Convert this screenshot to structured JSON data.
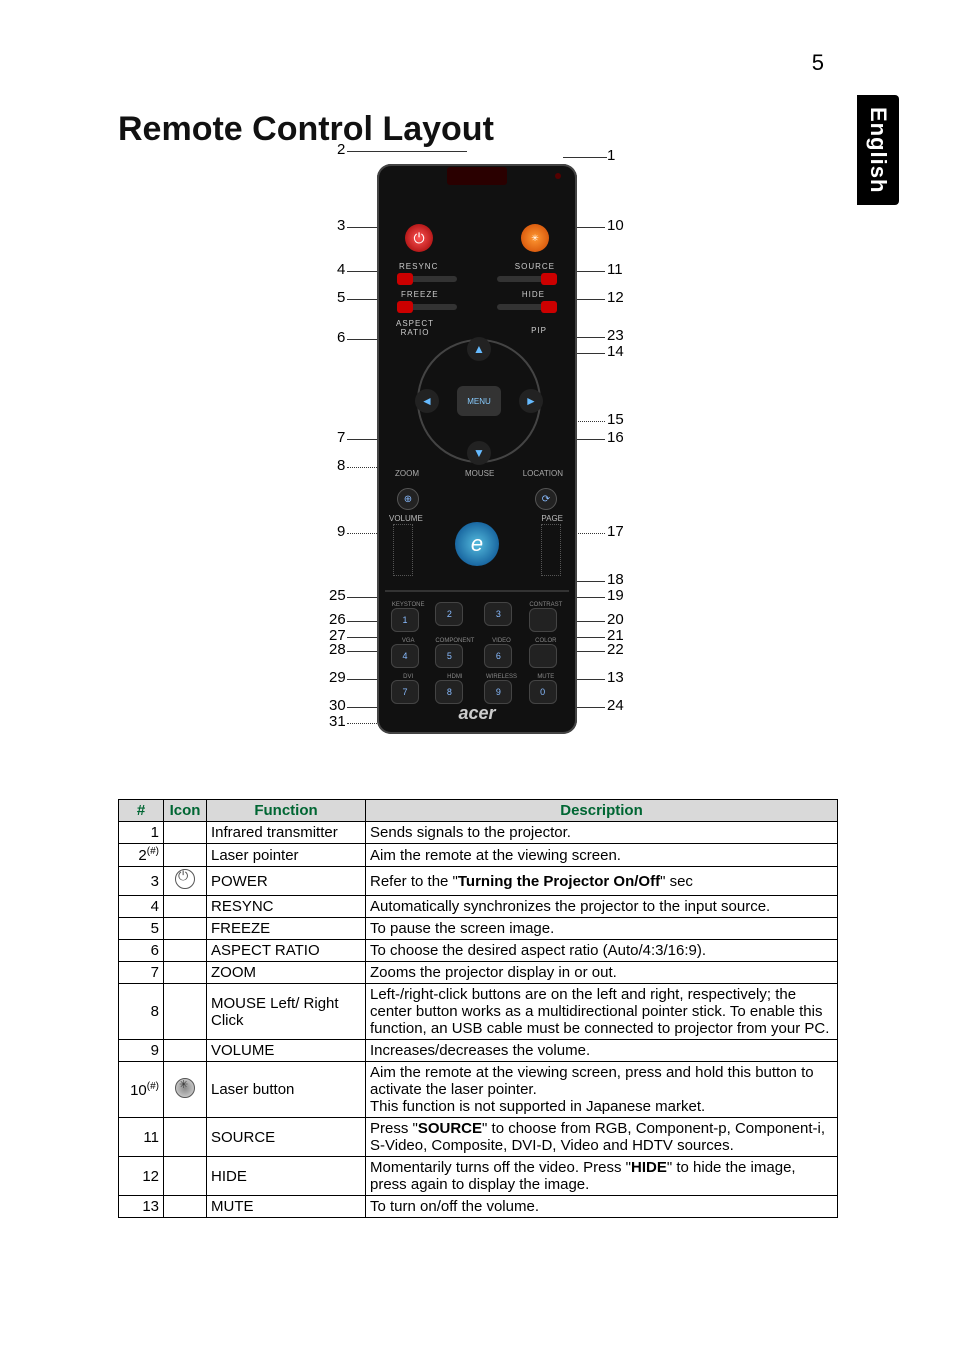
{
  "page_number": "5",
  "side_tab": "English",
  "title": "Remote Control Layout",
  "diagram": {
    "left_callouts": [
      "2",
      "3",
      "4",
      "5",
      "6",
      "7",
      "8",
      "9",
      "25",
      "26",
      "27",
      "28",
      "29",
      "30",
      "31"
    ],
    "right_callouts": [
      "1",
      "10",
      "11",
      "12",
      "23",
      "14",
      "15",
      "16",
      "17",
      "18",
      "19",
      "20",
      "21",
      "22",
      "13",
      "24"
    ],
    "remote_labels": {
      "resync": "RESYNC",
      "source": "SOURCE",
      "freeze": "FREEZE",
      "hide": "HIDE",
      "aspect": "ASPECT RATIO",
      "pip": "PIP",
      "menu": "MENU",
      "zoom": "ZOOM",
      "mouse": "MOUSE",
      "location": "LOCATION",
      "volume": "VOLUME",
      "page": "PAGE",
      "brand": "acer"
    },
    "key_labels": [
      "KEYSTONE",
      "",
      "",
      "CONTRAST",
      "VGA",
      "COMPONENT",
      "VIDEO",
      "COLOR",
      "DVI",
      "HDMI",
      "WIRELESS",
      "MUTE"
    ],
    "key_faces": [
      "1",
      "2",
      "3",
      "",
      "4",
      "5",
      "6",
      "",
      "7",
      "8",
      "9",
      "0"
    ]
  },
  "table": {
    "headers": {
      "num": "#",
      "icon": "Icon",
      "func": "Function",
      "desc": "Description"
    },
    "rows": [
      {
        "num": "1",
        "func": "Infrared transmitter",
        "desc": "Sends signals to the projector."
      },
      {
        "num": "2(#)",
        "func": "Laser pointer",
        "desc": "Aim the remote at the viewing screen."
      },
      {
        "num": "3",
        "icon": "power",
        "func": "POWER",
        "desc_pre": "Refer to the \"",
        "desc_bold": "Turning the Projector On/Off",
        "desc_post": "\" sec"
      },
      {
        "num": "4",
        "func": "RESYNC",
        "desc": "Automatically synchronizes the projector to the input source."
      },
      {
        "num": "5",
        "func": "FREEZE",
        "desc": "To pause the screen image."
      },
      {
        "num": "6",
        "func": "ASPECT RATIO",
        "desc": "To choose the desired aspect ratio (Auto/4:3/16:9)."
      },
      {
        "num": "7",
        "func": "ZOOM",
        "desc": "Zooms the projector display in or out."
      },
      {
        "num": "8",
        "func": "MOUSE Left/ Right Click",
        "desc": "Left-/right-click buttons are on the left and right, respectively; the center button works as a multidirectional pointer stick. To enable this function, an USB cable must be connected to projector from your PC."
      },
      {
        "num": "9",
        "func": "VOLUME",
        "desc": "Increases/decreases the volume."
      },
      {
        "num": "10(#)",
        "icon": "laser",
        "func": "Laser button",
        "desc": "Aim the remote at the viewing screen, press and hold this button to activate the laser pointer.\nThis function is not supported in Japanese market."
      },
      {
        "num": "11",
        "func": "SOURCE",
        "desc_pre": "Press \"",
        "desc_bold": "SOURCE",
        "desc_post": "\" to choose from RGB, Component-p, Component-i, S-Video, Composite, DVI-D, Video and HDTV sources."
      },
      {
        "num": "12",
        "func": "HIDE",
        "desc_pre": "Momentarily turns off the video. Press \"",
        "desc_bold": "HIDE",
        "desc_post": "\" to hide the image, press again to display the image."
      },
      {
        "num": "13",
        "func": "MUTE",
        "desc": "To turn on/off the volume."
      }
    ]
  }
}
